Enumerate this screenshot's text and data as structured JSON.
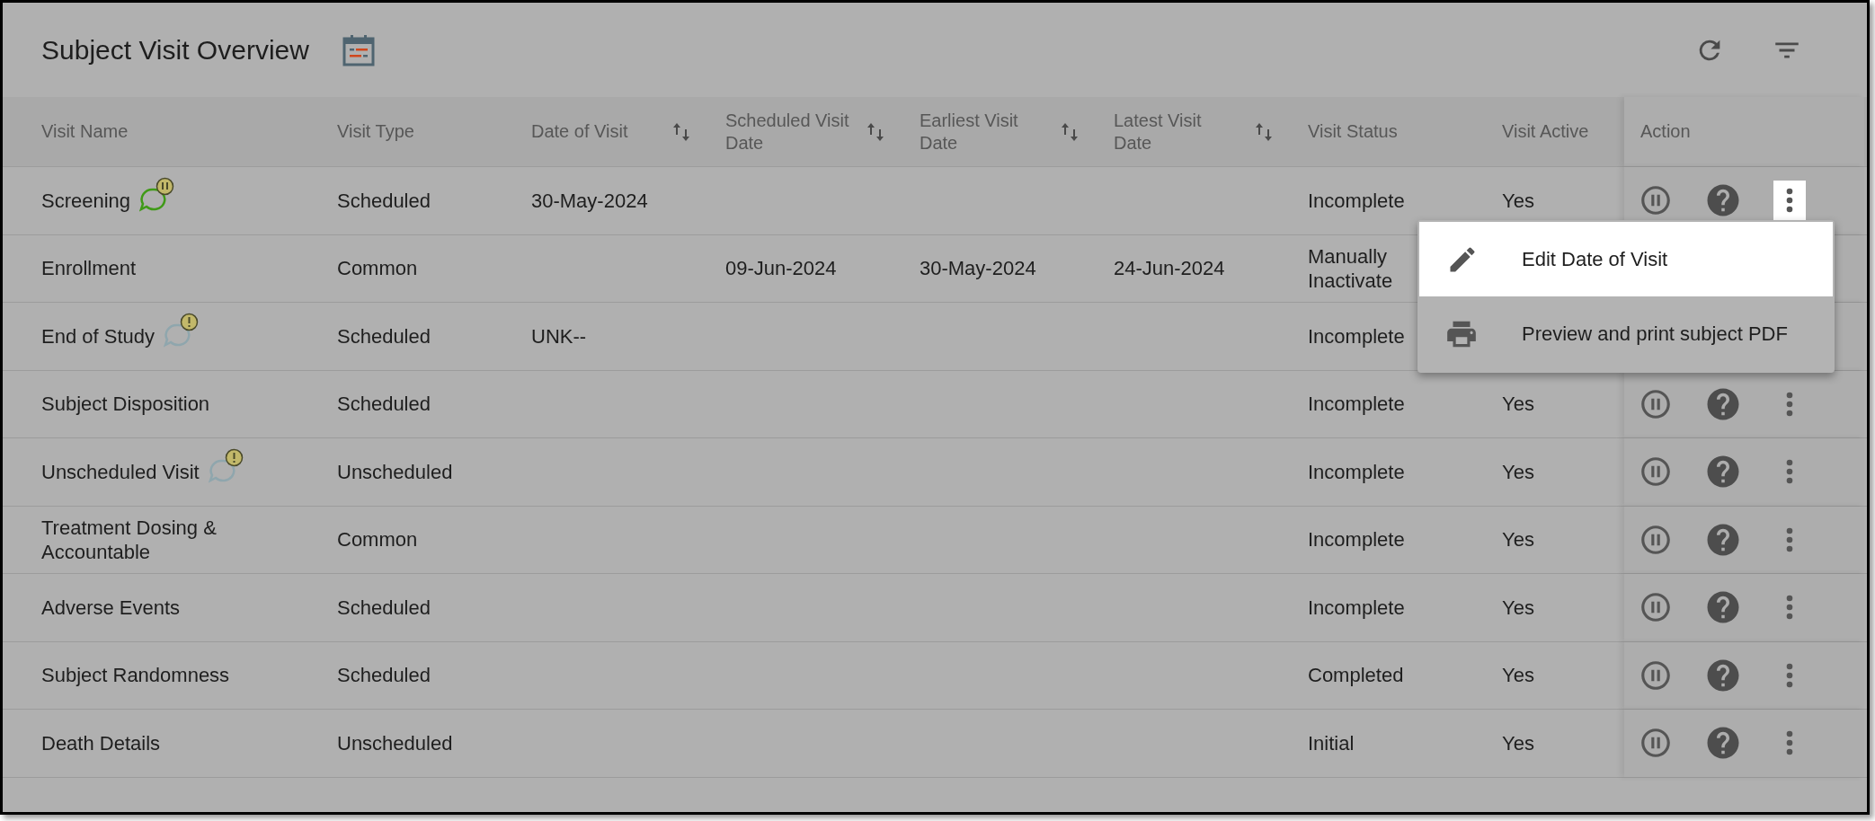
{
  "title": "Subject Visit Overview",
  "columns": [
    {
      "label": "Visit Name",
      "sortable": false
    },
    {
      "label": "Visit Type",
      "sortable": false
    },
    {
      "label": "Date of Visit",
      "sortable": true
    },
    {
      "label": "Scheduled Visit Date",
      "sortable": true
    },
    {
      "label": "Earliest Visit Date",
      "sortable": true
    },
    {
      "label": "Latest Visit Date",
      "sortable": true
    },
    {
      "label": "Visit Status",
      "sortable": false
    },
    {
      "label": "Visit Active",
      "sortable": false
    },
    {
      "label": "Action",
      "sortable": false
    }
  ],
  "rows": [
    {
      "cells": [
        "Screening",
        "Scheduled",
        "30-May-2024",
        "",
        "",
        "",
        "Incomplete",
        "Yes"
      ],
      "kind": "paused",
      "menu_open": true
    },
    {
      "cells": [
        "Enrollment",
        "Common",
        "",
        "09-Jun-2024",
        "30-May-2024",
        "24-Jun-2024",
        "Manually Inactivate",
        ""
      ],
      "kind": "plain",
      "menu_open": false
    },
    {
      "cells": [
        "End of Study",
        "Scheduled",
        "UNK--",
        "",
        "",
        "",
        "Incomplete",
        ""
      ],
      "kind": "warning",
      "menu_open": false
    },
    {
      "cells": [
        "Subject Disposition",
        "Scheduled",
        "",
        "",
        "",
        "",
        "Incomplete",
        "Yes"
      ],
      "kind": "plain",
      "menu_open": false
    },
    {
      "cells": [
        "Unscheduled Visit",
        "Unscheduled",
        "",
        "",
        "",
        "",
        "Incomplete",
        "Yes"
      ],
      "kind": "warning",
      "menu_open": false
    },
    {
      "cells": [
        "Treatment Dosing & Accountable",
        "Common",
        "",
        "",
        "",
        "",
        "Incomplete",
        "Yes"
      ],
      "kind": "plain",
      "menu_open": false
    },
    {
      "cells": [
        "Adverse Events",
        "Scheduled",
        "",
        "",
        "",
        "",
        "Incomplete",
        "Yes"
      ],
      "kind": "plain",
      "menu_open": false
    },
    {
      "cells": [
        "Subject Randomness",
        "Scheduled",
        "",
        "",
        "",
        "",
        "Completed",
        "Yes"
      ],
      "kind": "plain",
      "menu_open": false
    },
    {
      "cells": [
        "Death Details",
        "Unscheduled",
        "",
        "",
        "",
        "",
        "Initial",
        "Yes"
      ],
      "kind": "plain",
      "menu_open": false
    }
  ],
  "menu": [
    {
      "label": "Edit Date of Visit",
      "kind": "edit",
      "highlighted": true
    },
    {
      "label": "Preview and print subject PDF",
      "kind": "print",
      "highlighted": false
    }
  ]
}
